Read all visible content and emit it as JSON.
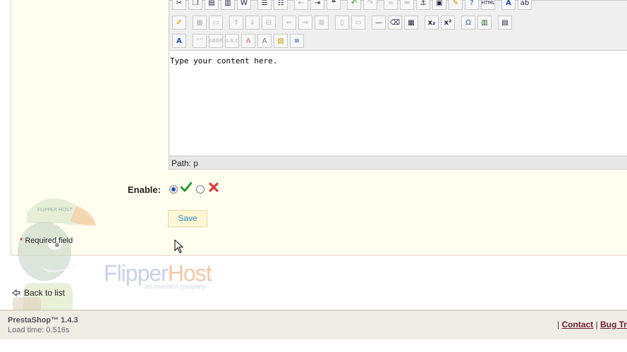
{
  "editor": {
    "content_text": "Type your content here.",
    "path_text": "Path: p"
  },
  "toolbar": {
    "row1": [
      "cut-icon",
      "copy-icon",
      "paste-icon",
      "paste-text-icon",
      "paste-word-icon",
      "bullet-list-icon",
      "numbered-list-icon",
      "outdent-icon",
      "indent-icon",
      "blockquote-icon",
      "undo-icon",
      "redo-icon",
      "link-icon",
      "unlink-icon",
      "anchor-icon",
      "image-icon",
      "cleanup-icon",
      "help-icon",
      "html-icon",
      "text-color-icon",
      "highlight-color-icon"
    ],
    "row2": [
      "edit-icon",
      "table-icon",
      "row-props-icon",
      "insert-row-before-icon",
      "insert-row-after-icon",
      "delete-row-icon",
      "insert-col-before-icon",
      "insert-col-after-icon",
      "delete-col-icon",
      "split-cells-icon",
      "merge-cells-icon",
      "horizontal-rule-icon",
      "remove-format-icon",
      "visual-aid-icon",
      "subscript-icon",
      "superscript-icon",
      "special-char-icon",
      "media-icon",
      "template-icon"
    ],
    "row3": [
      "styles-icon",
      "quote-icon",
      "abbreviation-icon",
      "acronym-icon",
      "strikethrough-icon",
      "text-icon",
      "attributes-icon",
      "nonbreaking-icon"
    ]
  },
  "form": {
    "enable_label": "Enable:",
    "enabled": true,
    "save_label": "Save",
    "required_star": "*",
    "required_text": "Required field"
  },
  "branding": {
    "logo_flipper": "Flipper",
    "logo_host": "Host",
    "tagline": "an investion company",
    "mascot_cap_text": "FLIPPER HOST"
  },
  "nav": {
    "back_label": "Back to list"
  },
  "footer": {
    "product": "PrestaShop™ 1.4.3",
    "load_time": "Load time: 0.516s",
    "separator": "|",
    "contact_label": "Contact",
    "bug_label": "Bug Trac"
  },
  "colors": {
    "panel_bg": "#fffff0",
    "save_text": "#268ccd",
    "footer_link": "#6b1e2a"
  }
}
